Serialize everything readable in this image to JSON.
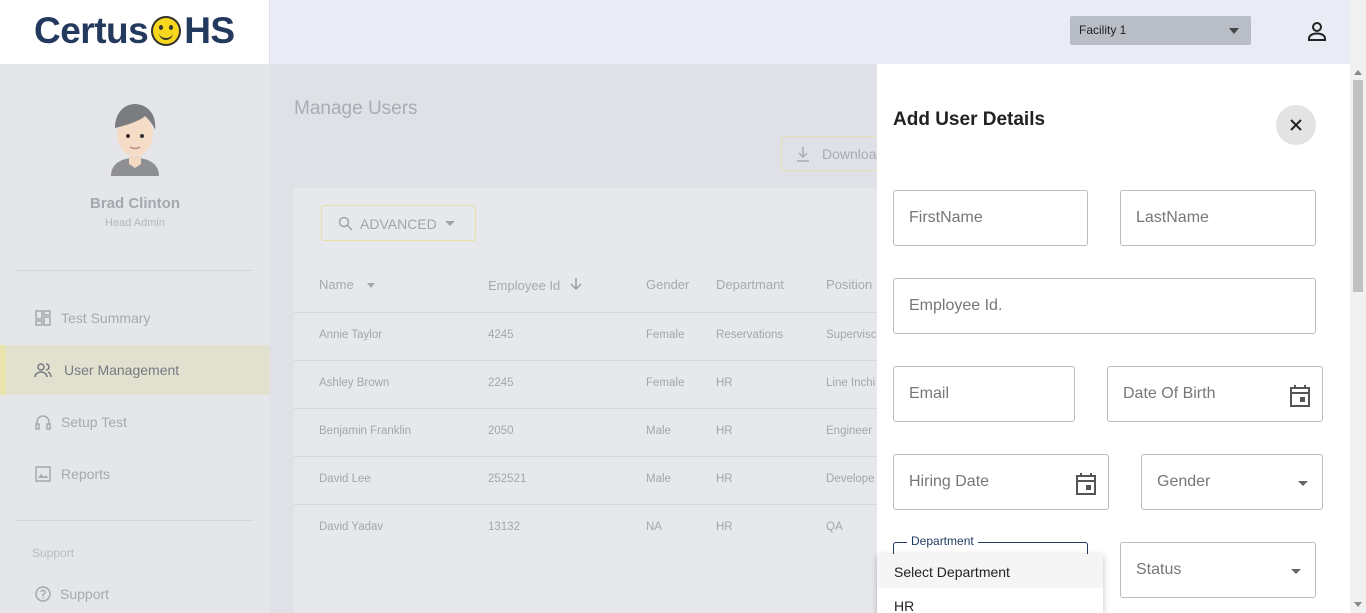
{
  "header": {
    "logo_left": "Certus",
    "logo_right": "HS",
    "facility": "Facility 1"
  },
  "sidebar": {
    "profile_name": "Brad Clinton",
    "profile_role": "Head Admin",
    "items": [
      {
        "label": "Test Summary",
        "icon": "dashboard-icon"
      },
      {
        "label": "User Management",
        "icon": "users-icon"
      },
      {
        "label": "Setup Test",
        "icon": "headset-icon"
      },
      {
        "label": "Reports",
        "icon": "image-icon"
      }
    ],
    "support_section": "Support",
    "support_item": "Support"
  },
  "main": {
    "title": "Manage Users",
    "download_label": "Downloa",
    "advanced_label": "ADVANCED",
    "columns": [
      "Name",
      "Employee Id",
      "Gender",
      "Departmant",
      "Position"
    ],
    "rows": [
      [
        "Annie Taylor",
        "4245",
        "Female",
        "Reservations",
        "Supervisc"
      ],
      [
        "Ashley Brown",
        "2245",
        "Female",
        "HR",
        "Line Inchi"
      ],
      [
        "Benjamin Franklin",
        "2050",
        "Male",
        "HR",
        "Engineer"
      ],
      [
        "David Lee",
        "252521",
        "Male",
        "HR",
        "Develope"
      ],
      [
        "David Yadav",
        "13132",
        "NA",
        "HR",
        "QA"
      ]
    ]
  },
  "drawer": {
    "title": "Add User Details",
    "fields": {
      "first_name": "FirstName",
      "last_name": "LastName",
      "employee_id": "Employee Id.",
      "email": "Email",
      "dob": "Date Of Birth",
      "hiring_date": "Hiring Date",
      "gender": "Gender",
      "department": "Department",
      "status": "Status"
    },
    "department_options": [
      "Select Department",
      "HR"
    ]
  },
  "colors": {
    "brand_navy": "#23395d",
    "accent_yellow": "#f9d71c"
  }
}
